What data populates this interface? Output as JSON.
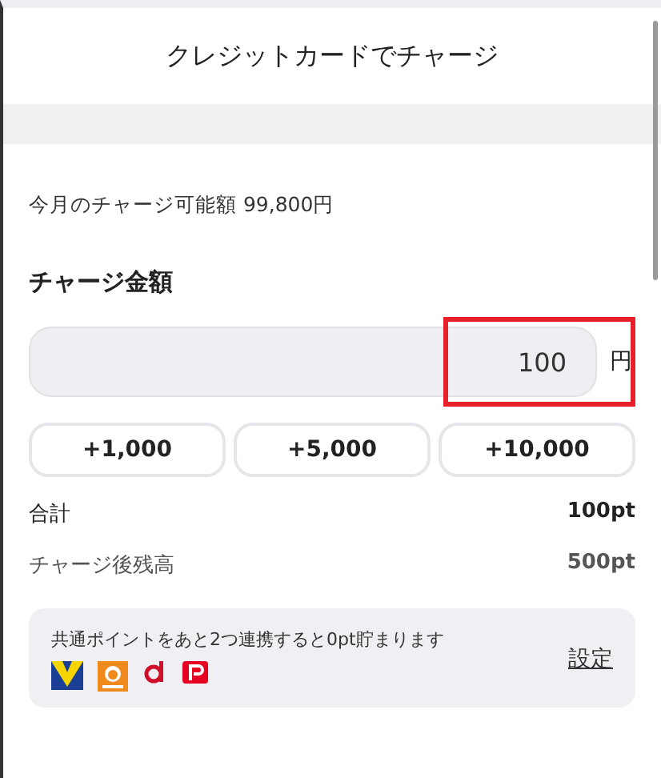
{
  "header": {
    "title": "クレジットカードでチャージ"
  },
  "limit_text": "今月のチャージ可能額 99,800円",
  "amount": {
    "label": "チャージ金額",
    "value": "100",
    "unit": "円"
  },
  "quick_buttons": [
    "+1,000",
    "+5,000",
    "+10,000"
  ],
  "summary": [
    {
      "label": "合計",
      "value": "100pt",
      "kind": "total"
    },
    {
      "label": "チャージ後残高",
      "value": "500pt",
      "kind": "balance"
    }
  ],
  "points_card": {
    "message": "共通ポイントをあと2つ連携すると0pt貯まります",
    "link": "設定",
    "logos": [
      {
        "kind": "v"
      },
      {
        "kind": "ponta"
      },
      {
        "kind": "d"
      },
      {
        "kind": "p"
      }
    ]
  }
}
